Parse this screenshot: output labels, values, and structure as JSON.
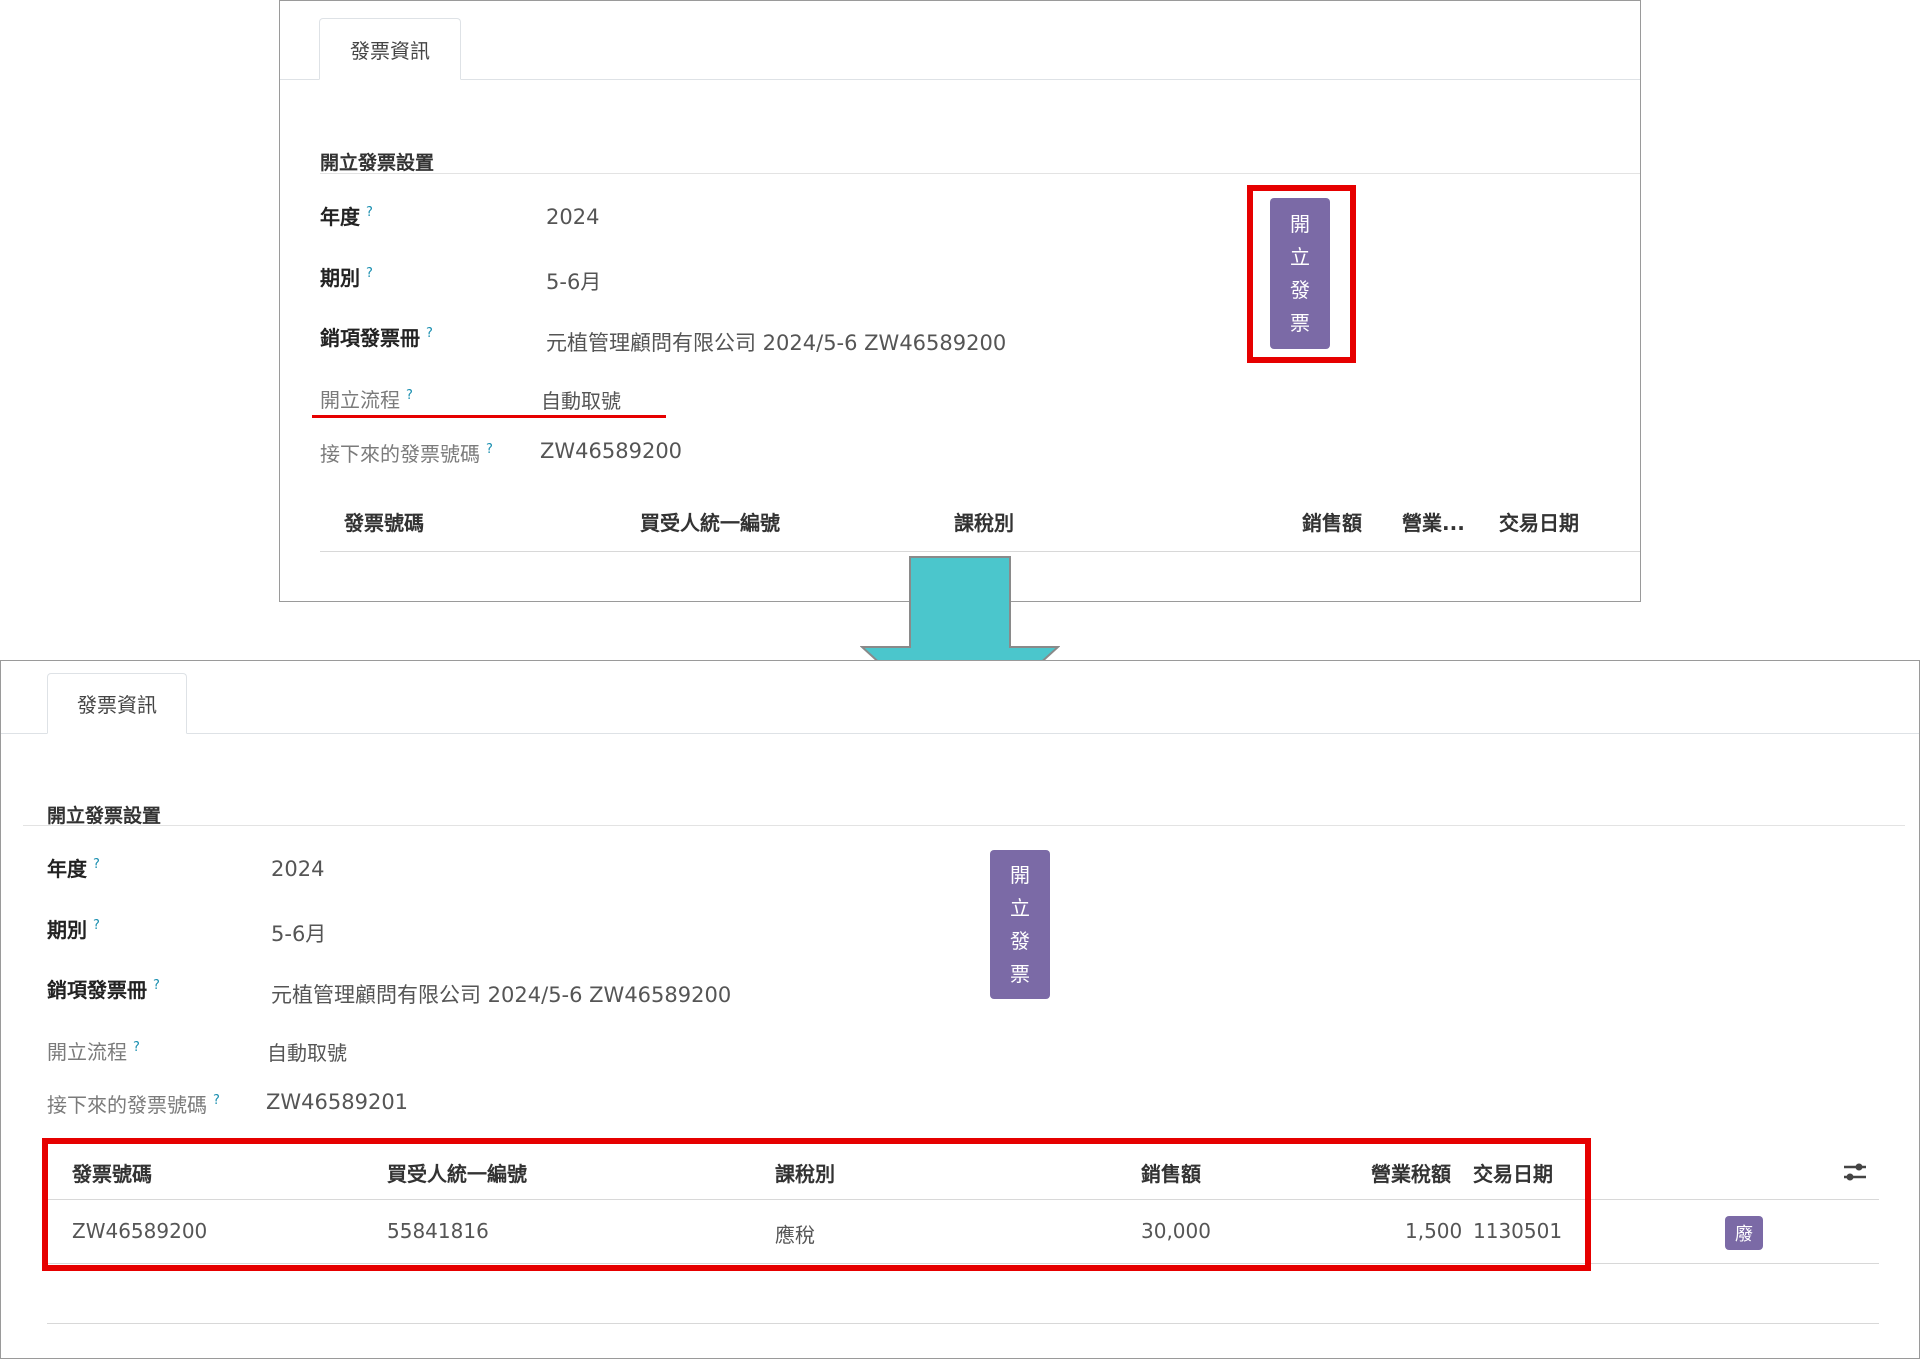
{
  "colors": {
    "accent": "#7b6aa6",
    "highlight": "#e60000",
    "arrow": "#4bc6cc"
  },
  "before": {
    "tab_label": "發票資訊",
    "section_title": "開立發票設置",
    "fields": {
      "year": {
        "label": "年度",
        "hint": "?",
        "value": "2024"
      },
      "period": {
        "label": "期別",
        "hint": "?",
        "value": "5-6月"
      },
      "book": {
        "label": "銷項發票冊",
        "hint": "?",
        "value": "元植管理顧問有限公司 2024/5-6 ZW46589200"
      },
      "flow": {
        "label": "開立流程",
        "hint": "?",
        "value": "自動取號"
      },
      "next_no": {
        "label": "接下來的發票號碼",
        "hint": "?",
        "value": "ZW46589200"
      }
    },
    "issue_button": [
      "開",
      "立",
      "發",
      "票"
    ],
    "table_headers": {
      "invoice_no": "發票號碼",
      "buyer_id": "買受人統一編號",
      "tax_type": "課稅別",
      "sales": "銷售額",
      "tax": "營業...",
      "date": "交易日期"
    }
  },
  "after": {
    "tab_label": "發票資訊",
    "section_title": "開立發票設置",
    "fields": {
      "year": {
        "label": "年度",
        "hint": "?",
        "value": "2024"
      },
      "period": {
        "label": "期別",
        "hint": "?",
        "value": "5-6月"
      },
      "book": {
        "label": "銷項發票冊",
        "hint": "?",
        "value": "元植管理顧問有限公司 2024/5-6 ZW46589200"
      },
      "flow": {
        "label": "開立流程",
        "hint": "?",
        "value": "自動取號"
      },
      "next_no": {
        "label": "接下來的發票號碼",
        "hint": "?",
        "value": "ZW46589201"
      }
    },
    "issue_button": [
      "開",
      "立",
      "發",
      "票"
    ],
    "table_headers": {
      "invoice_no": "發票號碼",
      "buyer_id": "買受人統一編號",
      "tax_type": "課稅別",
      "sales": "銷售額",
      "tax": "營業稅額",
      "date": "交易日期"
    },
    "rows": [
      {
        "invoice_no": "ZW46589200",
        "buyer_id": "55841816",
        "tax_type": "應稅",
        "sales": "30,000",
        "tax": "1,500",
        "date": "1130501",
        "action": "廢"
      }
    ]
  }
}
